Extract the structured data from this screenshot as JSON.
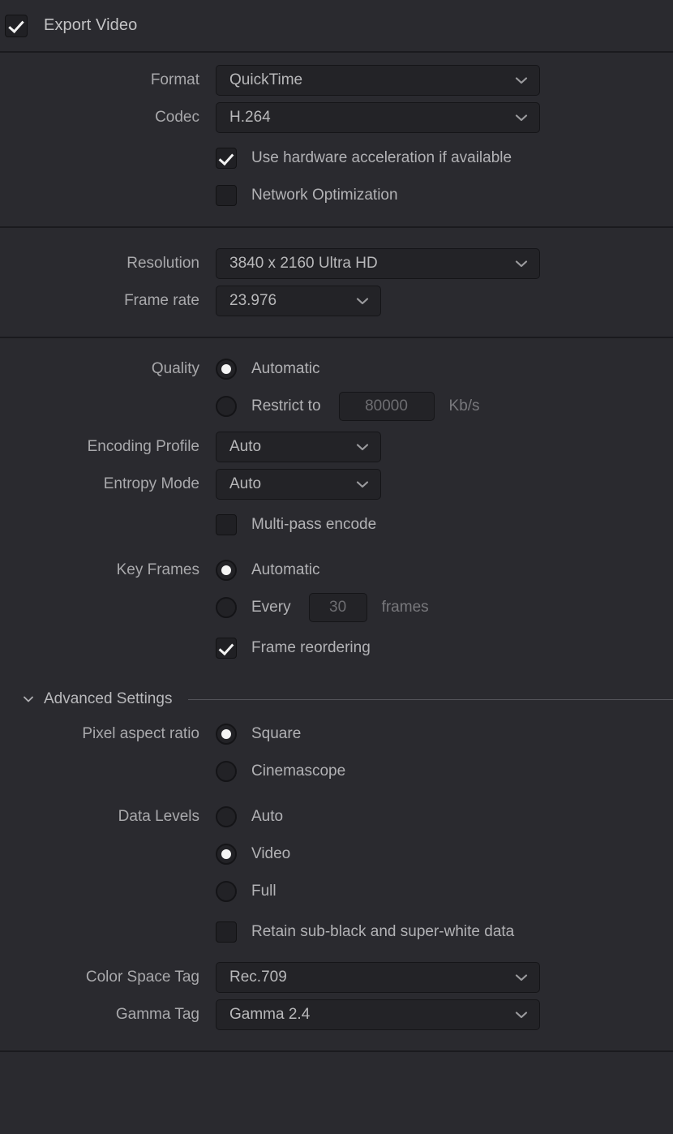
{
  "header": {
    "export_video_label": "Export Video",
    "export_video_checked": true
  },
  "format_section": {
    "format_label": "Format",
    "format_value": "QuickTime",
    "codec_label": "Codec",
    "codec_value": "H.264",
    "hw_accel_label": "Use hardware acceleration if available",
    "hw_accel_checked": true,
    "network_opt_label": "Network Optimization",
    "network_opt_checked": false
  },
  "resolution_section": {
    "resolution_label": "Resolution",
    "resolution_value": "3840 x 2160 Ultra HD",
    "framerate_label": "Frame rate",
    "framerate_value": "23.976"
  },
  "quality_section": {
    "quality_label": "Quality",
    "automatic_label": "Automatic",
    "automatic_selected": true,
    "restrict_label": "Restrict to",
    "restrict_selected": false,
    "restrict_value": "80000",
    "restrict_unit": "Kb/s",
    "encoding_profile_label": "Encoding Profile",
    "encoding_profile_value": "Auto",
    "entropy_mode_label": "Entropy Mode",
    "entropy_mode_value": "Auto",
    "multipass_label": "Multi-pass encode",
    "multipass_checked": false,
    "keyframes_label": "Key Frames",
    "keyframes_auto_label": "Automatic",
    "keyframes_auto_selected": true,
    "keyframes_every_label": "Every",
    "keyframes_every_selected": false,
    "keyframes_every_value": "30",
    "keyframes_every_unit": "frames",
    "frame_reordering_label": "Frame reordering",
    "frame_reordering_checked": true
  },
  "advanced_section": {
    "title": "Advanced Settings",
    "expanded": true,
    "pixel_aspect_label": "Pixel aspect ratio",
    "square_label": "Square",
    "square_selected": true,
    "cinemascope_label": "Cinemascope",
    "cinemascope_selected": false,
    "data_levels_label": "Data Levels",
    "auto_label": "Auto",
    "auto_selected": false,
    "video_label": "Video",
    "video_selected": true,
    "full_label": "Full",
    "full_selected": false,
    "retain_label": "Retain sub-black and super-white data",
    "retain_checked": false,
    "color_space_label": "Color Space Tag",
    "color_space_value": "Rec.709",
    "gamma_label": "Gamma Tag",
    "gamma_value": "Gamma 2.4"
  },
  "icons": {
    "chevron_down": "chevron-down-icon",
    "checkmark": "checkmark-icon",
    "radio_dot": "radio-dot-icon",
    "disclosure": "disclosure-triangle-icon"
  },
  "colors": {
    "panel_bg": "#2a2a2f",
    "field_bg": "#232327",
    "field_border": "#151518",
    "separator": "#1a1a1e",
    "text_primary": "#b8b8ba",
    "text_label": "#a9a9ac",
    "text_disabled": "#6d6d71",
    "accent_white": "#f2f2f2",
    "rule_light": "#54545a"
  }
}
